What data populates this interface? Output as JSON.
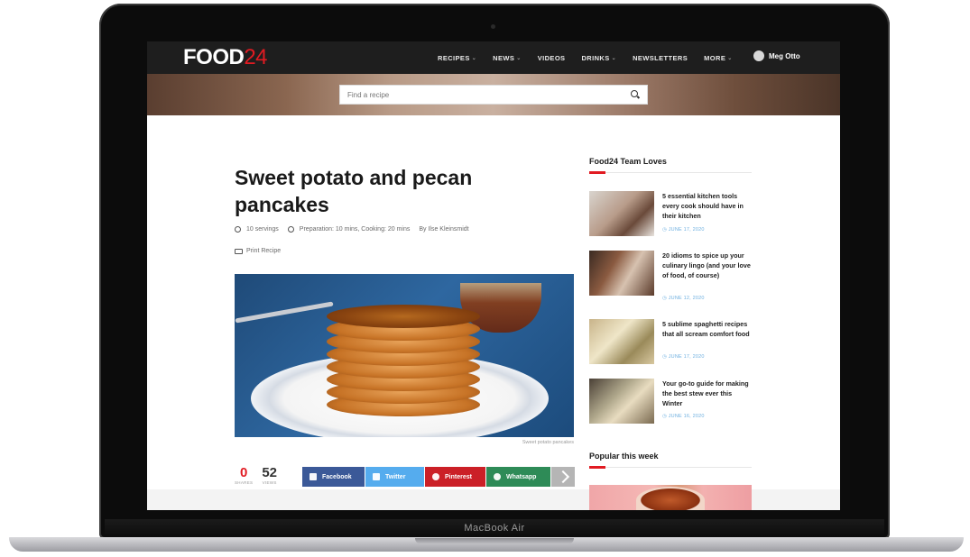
{
  "device": {
    "model_label": "MacBook Air"
  },
  "header": {
    "logo_main": "FOOD",
    "logo_num": "24",
    "nav": [
      {
        "label": "RECIPES",
        "has_dropdown": true
      },
      {
        "label": "NEWS",
        "has_dropdown": true
      },
      {
        "label": "VIDEOS",
        "has_dropdown": false
      },
      {
        "label": "DRINKS",
        "has_dropdown": true
      },
      {
        "label": "NEWSLETTERS",
        "has_dropdown": false
      },
      {
        "label": "MORE",
        "has_dropdown": true
      }
    ],
    "user_name": "Meg Otto"
  },
  "search": {
    "placeholder": "Find a recipe",
    "icon": "search-icon"
  },
  "article": {
    "title": "Sweet potato and pecan pancakes",
    "servings": "10 servings",
    "time": "Preparation: 10 mins, Cooking: 20 mins",
    "author": "By Ilse Kleinsmidt",
    "print_label": "Print Recipe",
    "image_caption": "Sweet potato pancakes",
    "shares_count": "0",
    "shares_label": "SHARES",
    "views_count": "52",
    "views_label": "VIEWS",
    "share_buttons": {
      "facebook": "Facebook",
      "twitter": "Twitter",
      "pinterest": "Pinterest",
      "whatsapp": "Whatsapp"
    }
  },
  "sidebar": {
    "team_loves_title": "Food24 Team Loves",
    "items": [
      {
        "title": "5 essential kitchen tools every cook should have in their kitchen",
        "date": "JUNE 17, 2020"
      },
      {
        "title": "20 idioms to spice up your culinary lingo (and your love of food, of course)",
        "date": "JUNE 12, 2020"
      },
      {
        "title": "5 sublime spaghetti recipes that all scream comfort food",
        "date": "JUNE 17, 2020"
      },
      {
        "title": "Your go-to guide for making the best stew ever this Winter",
        "date": "JUNE 16, 2020"
      }
    ],
    "popular_title": "Popular this week"
  },
  "colors": {
    "brand_red": "#e11b22",
    "nav_bg": "#1e1e1e",
    "facebook": "#3b5998",
    "twitter": "#55acee",
    "pinterest": "#cb2027",
    "whatsapp": "#2e8b57"
  }
}
